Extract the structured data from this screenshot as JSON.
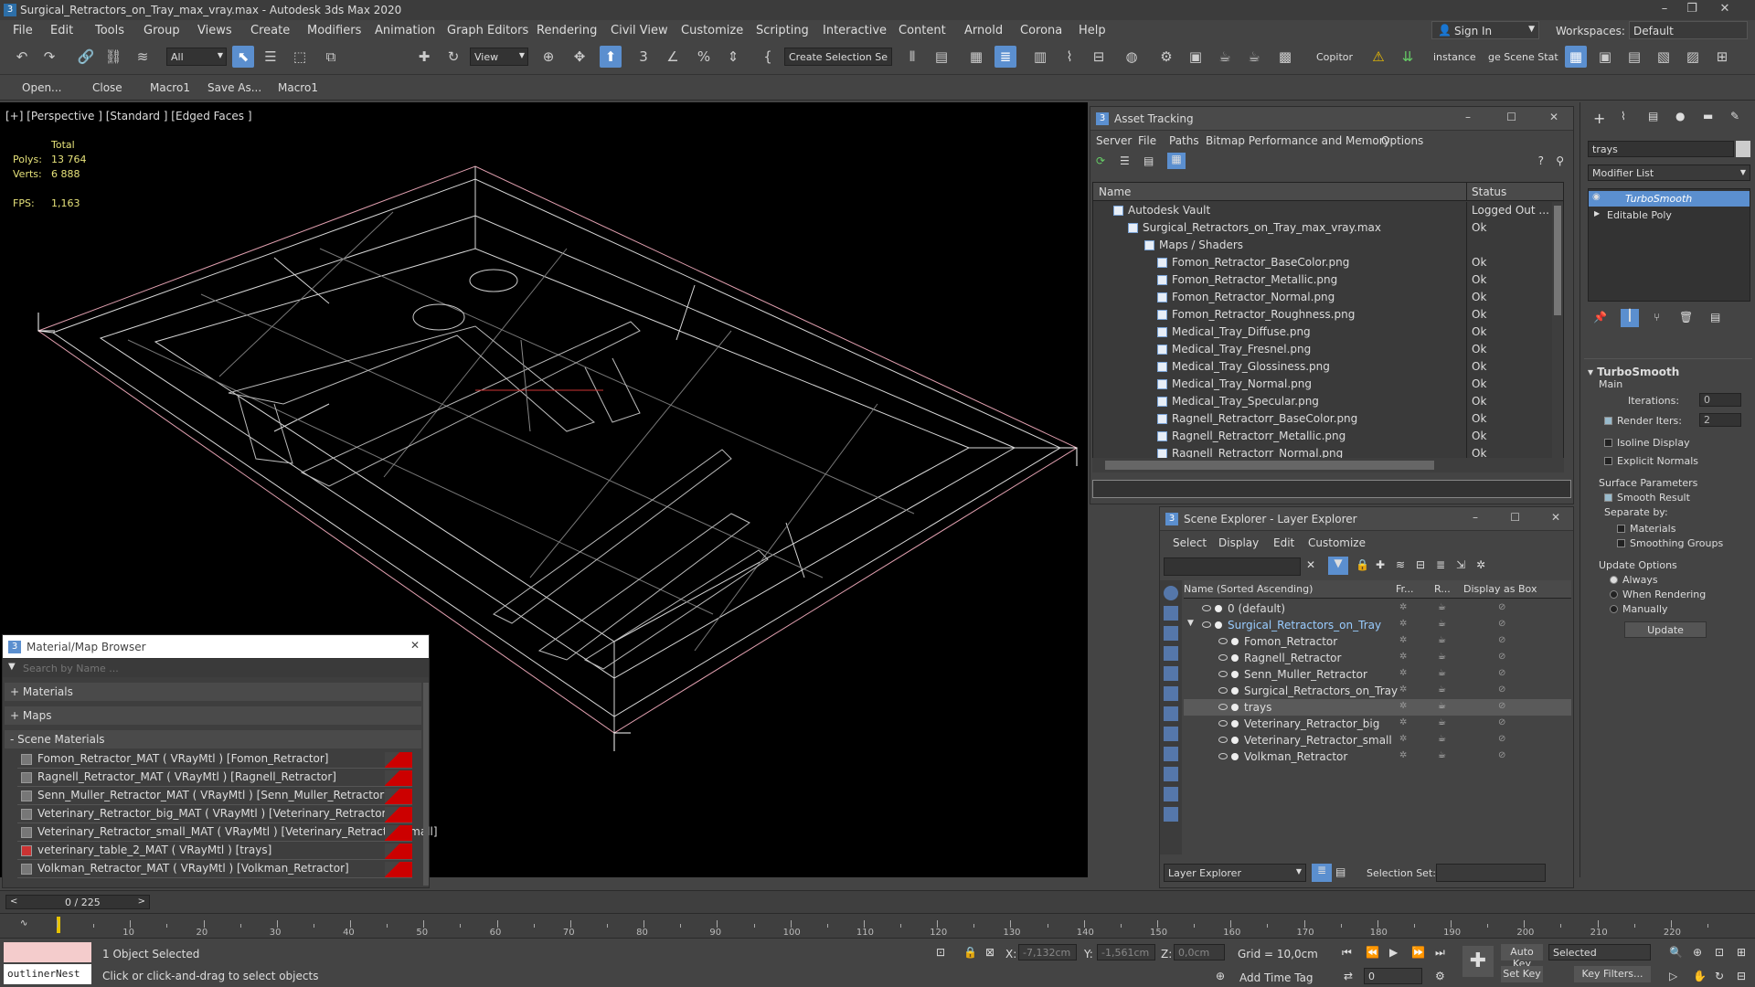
{
  "window": {
    "title": "Surgical_Retractors_on_Tray_max_vray.max - Autodesk 3ds Max 2020"
  },
  "menu": [
    "File",
    "Edit",
    "Tools",
    "Group",
    "Views",
    "Create",
    "Modifiers",
    "Animation",
    "Graph Editors",
    "Rendering",
    "Civil View",
    "Customize",
    "Scripting",
    "Interactive",
    "Content",
    "Arnold",
    "Corona",
    "Help"
  ],
  "account": {
    "sign_in": "Sign In",
    "workspaces_label": "Workspaces:",
    "workspace": "Default"
  },
  "toolbar": {
    "filter": "All",
    "view": "View",
    "selection_set": "Create Selection Se",
    "copitor": "Copitor",
    "instance": "instance",
    "scene_state": "ge Scene Stat"
  },
  "toolbar2": [
    "Open...",
    "Close",
    "Macro1",
    "Save As...",
    "Macro1"
  ],
  "viewport": {
    "label": "[+] [Perspective ] [Standard ] [Edged Faces ]",
    "stats": {
      "total": "Total",
      "polys_label": "Polys:",
      "polys": "13 764",
      "verts_label": "Verts:",
      "verts": "6 888",
      "fps_label": "FPS:",
      "fps": "1,163"
    }
  },
  "asset_tracking": {
    "title": "Asset Tracking",
    "menu": [
      "Server",
      "File",
      "Paths",
      "Bitmap Performance and Memory",
      "Options"
    ],
    "col_name": "Name",
    "col_status": "Status",
    "rows": [
      {
        "name": "Autodesk Vault",
        "status": "Logged Out ..."
      },
      {
        "name": "Surgical_Retractors_on_Tray_max_vray.max",
        "status": "Ok"
      },
      {
        "name": "Maps / Shaders",
        "status": ""
      },
      {
        "name": "Fomon_Retractor_BaseColor.png",
        "status": "Ok"
      },
      {
        "name": "Fomon_Retractor_Metallic.png",
        "status": "Ok"
      },
      {
        "name": "Fomon_Retractor_Normal.png",
        "status": "Ok"
      },
      {
        "name": "Fomon_Retractor_Roughness.png",
        "status": "Ok"
      },
      {
        "name": "Medical_Tray_Diffuse.png",
        "status": "Ok"
      },
      {
        "name": "Medical_Tray_Fresnel.png",
        "status": "Ok"
      },
      {
        "name": "Medical_Tray_Glossiness.png",
        "status": "Ok"
      },
      {
        "name": "Medical_Tray_Normal.png",
        "status": "Ok"
      },
      {
        "name": "Medical_Tray_Specular.png",
        "status": "Ok"
      },
      {
        "name": "Ragnell_Retractorr_BaseColor.png",
        "status": "Ok"
      },
      {
        "name": "Ragnell_Retractorr_Metallic.png",
        "status": "Ok"
      },
      {
        "name": "Ragnell_Retractorr_Normal.png",
        "status": "Ok"
      }
    ]
  },
  "scene_explorer": {
    "title": "Scene Explorer - Layer Explorer",
    "menu": [
      "Select",
      "Display",
      "Edit",
      "Customize"
    ],
    "col_name": "Name (Sorted Ascending)",
    "col_fr": "Fr...",
    "col_r": "R...",
    "col_box": "Display as Box",
    "rows": [
      {
        "name": "0 (default)",
        "level": 0
      },
      {
        "name": "Surgical_Retractors_on_Tray",
        "level": 0
      },
      {
        "name": "Fomon_Retractor",
        "level": 1
      },
      {
        "name": "Ragnell_Retractor",
        "level": 1
      },
      {
        "name": "Senn_Muller_Retractor",
        "level": 1
      },
      {
        "name": "Surgical_Retractors_on_Tray",
        "level": 1
      },
      {
        "name": "trays",
        "level": 1
      },
      {
        "name": "Veterinary_Retractor_big",
        "level": 1
      },
      {
        "name": "Veterinary_Retractor_small",
        "level": 1
      },
      {
        "name": "Volkman_Retractor",
        "level": 1
      }
    ],
    "footer_dropdown": "Layer Explorer",
    "selection_set_label": "Selection Set:"
  },
  "material_browser": {
    "title": "Material/Map Browser",
    "search_placeholder": "Search by Name ...",
    "groups": [
      "+ Materials",
      "+ Maps",
      "- Scene Materials"
    ],
    "materials": [
      "Fomon_Retractor_MAT ( VRayMtl ) [Fomon_Retractor]",
      "Ragnell_Retractor_MAT ( VRayMtl ) [Ragnell_Retractor]",
      "Senn_Muller_Retractor_MAT ( VRayMtl ) [Senn_Muller_Retractor]",
      "Veterinary_Retractor_big_MAT ( VRayMtl ) [Veterinary_Retractor_big]",
      "Veterinary_Retractor_small_MAT ( VRayMtl ) [Veterinary_Retractor_small]",
      "veterinary_table_2_MAT ( VRayMtl ) [trays]",
      "Volkman_Retractor_MAT ( VRayMtl ) [Volkman_Retractor]"
    ]
  },
  "command_panel": {
    "object_name": "trays",
    "modifier_list": "Modifier List",
    "stack": [
      "TurboSmooth",
      "Editable Poly"
    ],
    "rollout": "TurboSmooth",
    "main": "Main",
    "iterations_label": "Iterations:",
    "iterations": "0",
    "render_iters_label": "Render Iters:",
    "render_iters": "2",
    "isoline": "Isoline Display",
    "explicit": "Explicit Normals",
    "surface_params": "Surface Parameters",
    "smooth_result": "Smooth Result",
    "separate_by": "Separate by:",
    "materials": "Materials",
    "smoothing_groups": "Smoothing Groups",
    "update_options": "Update Options",
    "always": "Always",
    "when_rendering": "When Rendering",
    "manually": "Manually",
    "update_btn": "Update"
  },
  "timeline": {
    "frame": "0 / 225",
    "ticks": [
      "10",
      "20",
      "30",
      "40",
      "50",
      "60",
      "70",
      "80",
      "90",
      "100",
      "110",
      "120",
      "130",
      "140",
      "150",
      "160",
      "170",
      "180",
      "190",
      "200",
      "210",
      "220"
    ]
  },
  "status": {
    "listener": "outlinerNest",
    "selected": "1 Object Selected",
    "prompt": "Click or click-and-drag to select objects",
    "x_label": "X:",
    "x": "-7,132cm",
    "y_label": "Y:",
    "y": "-1,561cm",
    "z_label": "Z:",
    "z": "0,0cm",
    "grid": "Grid = 10,0cm",
    "add_time_tag": "Add Time Tag",
    "auto_key": "Auto Key",
    "set_key": "Set Key",
    "selected_dd": "Selected",
    "key_filters": "Key Filters...",
    "frame_field": "0"
  }
}
